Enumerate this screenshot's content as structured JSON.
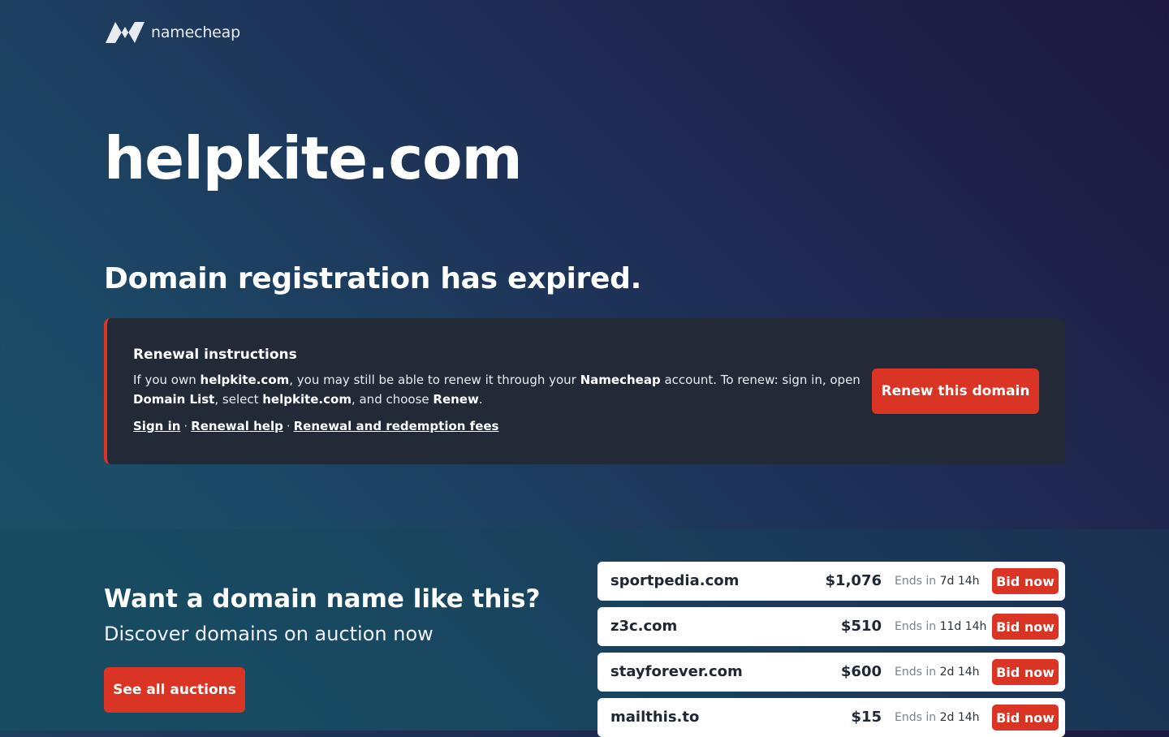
{
  "brand": {
    "name": "namecheap",
    "logo_icon": "namecheap-logo-icon",
    "accent_color": "#d93424"
  },
  "domain": {
    "name": "helpkite.com"
  },
  "status": {
    "heading": "Domain registration has expired."
  },
  "renewal": {
    "title": "Renewal instructions",
    "text": {
      "p1": "If you own ",
      "domain1": "helpkite.com",
      "p2": ", you may still be able to renew it through your ",
      "brand": "Namecheap",
      "p3": " account. To renew: sign in, open ",
      "list": "Domain List",
      "p4": ", select ",
      "domain2": "helpkite.com",
      "p5": ", and choose ",
      "action": "Renew",
      "p6": "."
    },
    "links": {
      "sign_in": "Sign in",
      "renewal_help": "Renewal help",
      "fees": "Renewal and redemption fees",
      "separator": "·"
    },
    "button_label": "Renew this domain"
  },
  "auctions_promo": {
    "heading": "Want a domain name like this?",
    "subheading": "Discover domains on auction now",
    "button_label": "See all auctions",
    "ends_prefix": "Ends in",
    "bid_label": "Bid now",
    "items": [
      {
        "name": "sportpedia.com",
        "price": "$1,076",
        "ends": "7d 14h"
      },
      {
        "name": "z3c.com",
        "price": "$510",
        "ends": "11d 14h"
      },
      {
        "name": "stayforever.com",
        "price": "$600",
        "ends": "2d 14h"
      },
      {
        "name": "mailthis.to",
        "price": "$15",
        "ends": "2d 14h"
      }
    ]
  }
}
